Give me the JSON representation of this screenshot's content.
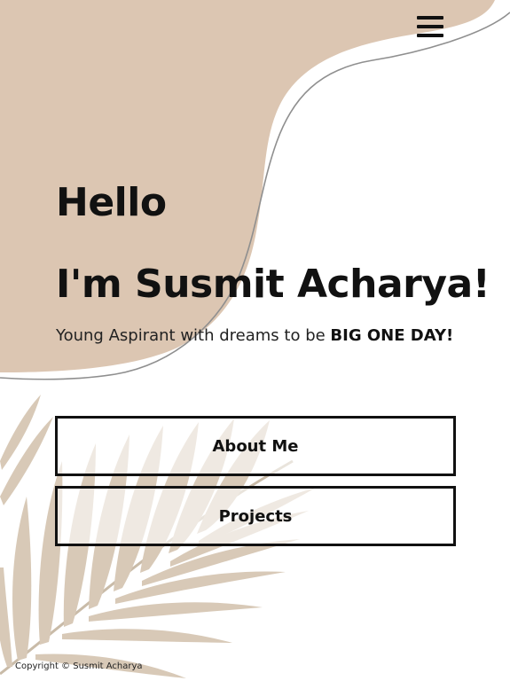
{
  "header": {
    "menu_icon": "hamburger-menu-icon"
  },
  "hero": {
    "greeting": "Hello",
    "name_line": "I'm Susmit Acharya!",
    "tagline_prefix": "Young Aspirant with dreams to be ",
    "tagline_emphasis": "BIG ONE DAY!"
  },
  "buttons": {
    "about": "About Me",
    "projects": "Projects"
  },
  "footer": {
    "copyright": "Copyright © Susmit Acharya"
  },
  "colors": {
    "background": "#ffffff",
    "blob": "#dcc6b2",
    "blob_outline": "#8f8f8f",
    "leaf": "#cbb8a0",
    "text": "#111111"
  }
}
